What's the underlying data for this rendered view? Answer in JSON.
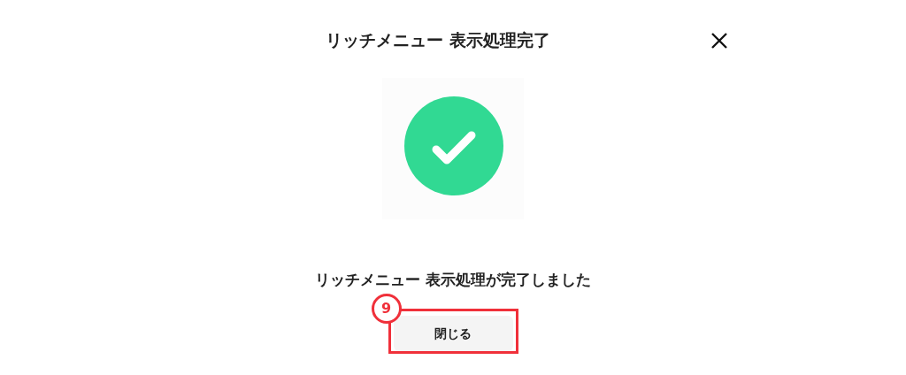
{
  "dialog": {
    "title": "リッチメニュー 表示処理完了",
    "message": "リッチメニュー 表示処理が完了しました",
    "close_button": {
      "label": "閉じる"
    }
  },
  "annotation": {
    "number": "9"
  }
}
